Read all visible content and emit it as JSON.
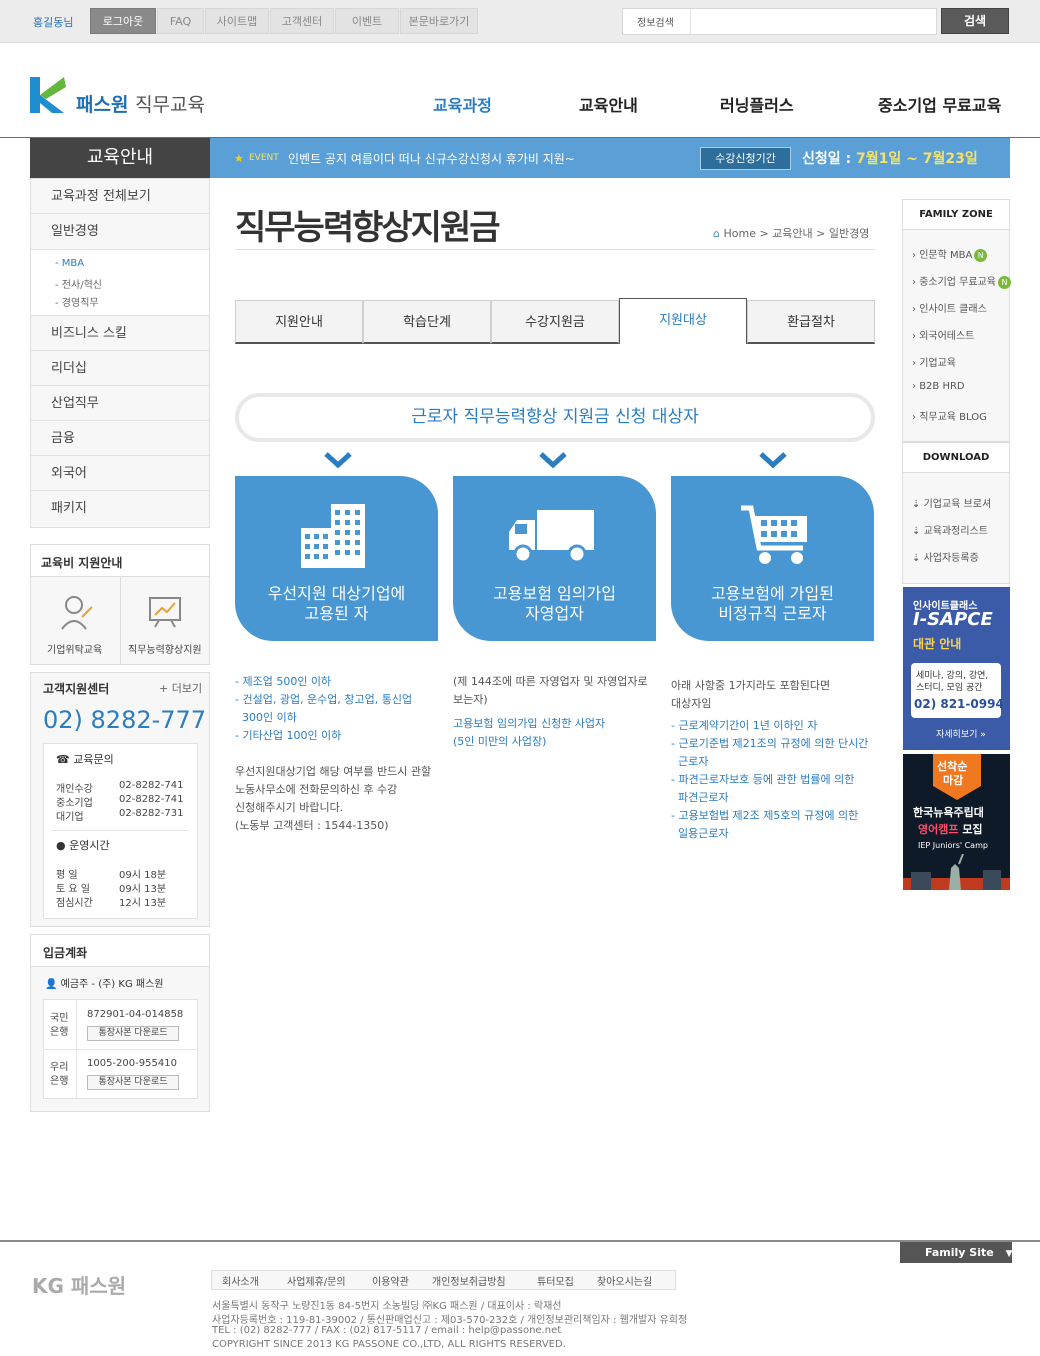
{
  "topbar": {
    "user": "홍길동님",
    "links": [
      "로그아웃",
      "FAQ",
      "사이트맵",
      "고객센터",
      "이벤트",
      "본문바로가기"
    ],
    "search_label": "정보검색",
    "search_placeholder": "",
    "search_button": "검색"
  },
  "logo": {
    "brand": "패스원",
    "sub": "직무교육"
  },
  "gnb": [
    "교육과정",
    "교육안내",
    "러닝플러스",
    "중소기업 무료교육"
  ],
  "lnb": {
    "title": "교육안내",
    "items": [
      "교육과정 전체보기",
      "일반경영",
      "비즈니스 스킬",
      "리더십",
      "산업직무",
      "금융",
      "외국어",
      "패키지"
    ],
    "subitems": [
      "MBA",
      "전사/혁신",
      "경영직무"
    ]
  },
  "event": {
    "label": "EVENT",
    "text": "인벤트 공지 여름이다 떠나 신규수강신청시 휴가비 지원~",
    "tag": "수강신청기간",
    "date_prefix": "신청일 :",
    "date_value": "7월1일 ~ 7월23일"
  },
  "support_panel": {
    "title": "교육비 지원안내",
    "items": [
      "기업위탁교육",
      "직무능력향상지원"
    ]
  },
  "cs_center": {
    "title": "고객지원센터",
    "more": "+ 더보기",
    "phone": "02) 8282-777",
    "inquiry_title": "교육문의",
    "inquiry": [
      {
        "label": "개인수강",
        "value": "02-8282-741"
      },
      {
        "label": "중소기업",
        "value": "02-8282-741"
      },
      {
        "label": "대기업",
        "value": "02-8282-731"
      }
    ],
    "hours_title": "운영시간",
    "hours": [
      {
        "label": "평 일",
        "value": "09시 18분"
      },
      {
        "label": "토 요 일",
        "value": "09시 13분"
      },
      {
        "label": "점심시간",
        "value": "12시 13분"
      }
    ]
  },
  "account": {
    "title": "입금계좌",
    "holder": "예금주 - (주) KG 패스원",
    "banks": [
      {
        "name": "국민\n은행",
        "number": "872901-04-014858",
        "button": "통장사본 다운로드"
      },
      {
        "name": "우리\n은행",
        "number": "1005-200-955410",
        "button": "통장사본 다운로드"
      }
    ]
  },
  "page": {
    "title": "직무능력향상지원금",
    "breadcrumb": "Home > 교육안내 > 일반경영"
  },
  "tabs": [
    "지원안내",
    "학습단계",
    "수강지원금",
    "지원대상",
    "환급절차"
  ],
  "active_tab": 3,
  "section_title": "근로자 직무능력향상 지원금 신청 대상자",
  "cards": [
    {
      "line1": "우선지원 대상기업에",
      "line2": "고용된 자"
    },
    {
      "line1": "고용보험 임의가입",
      "line2": "자영업자"
    },
    {
      "line1": "고용보험에 가입된",
      "line2": "비정규직 근로자"
    }
  ],
  "notes": {
    "col1_blue": [
      "- 제조업 500인 이하",
      "- 건설업, 광업, 운수업, 창고업, 통신업",
      "  300인 이하",
      "- 기타산업 100인 이하"
    ],
    "col1_gray": [
      "우선지원대상기업 해당 여부를 반드시 관할",
      "노동사무소에 전화문의하신 후 수강",
      "신청해주시기 바랍니다.",
      "(노동부 고객센터 : 1544-1350)"
    ],
    "col2_gray": [
      "(제 144조에 따른 자영업자 및 자영업자로",
      "보는자)"
    ],
    "col2_blue": [
      "고용보험 임의가입 신청한 사업자",
      "(5인 미만의 사업장)"
    ],
    "col3_gray": [
      "아래 사항중 1가지라도 포함된다면",
      "대상자임"
    ],
    "col3_blue": [
      "- 근로계약기간이 1년 이하인 자",
      "- 근로기준법 제21조의 규정에 의한 단시간",
      "  근로자",
      "- 파견근로자보호 등에 관한 법률에 의한",
      "  파견근로자",
      "- 고용보험법 제2조 제5호의 규정에 의한",
      "  일용근로자"
    ]
  },
  "family_zone": {
    "title": "FAMILY ZONE",
    "items": [
      "인문학 MBA",
      "중소기업 무료교육",
      "인사이트 클래스",
      "외국어테스트",
      "기업교육",
      "B2B HRD",
      "직무교육 BLOG"
    ],
    "new_badge": "N"
  },
  "download": {
    "title": "DOWNLOAD",
    "items": [
      "기업교육 브로셔",
      "교육과정리스트",
      "사업자등록증"
    ]
  },
  "banner1": {
    "line1": "인사이트클래스",
    "line2": "I-SAPCE",
    "line3": "대관 안내",
    "desc1": "세미나, 강의, 강연,",
    "desc2": "스터디, 모임 공간",
    "phone": "02) 821-0994",
    "more": "자세히보기 »"
  },
  "banner2": {
    "badge1": "선착순",
    "badge2": "마감",
    "line1": "한국뉴욕주립대",
    "line2": "영어캠프",
    "line2b": " 모집",
    "line3": "IEP Juniors' Camp"
  },
  "footer": {
    "family_site": "Family Site",
    "logo": "KG 패스원",
    "menu": [
      "회사소개",
      "사업제휴/문의",
      "이용약관",
      "개인정보취급방침",
      "튜터모집",
      "찾아오시는길"
    ],
    "address": [
      "서울특별시 동작구 노량진1동 84-5번지 소농빌딩 ㈜KG 패스원 / 대표이사 : 락재선",
      "사업자등록번호 : 119-81-39002 / 통신판매업신고 : 제03-570-232호 / 개인정보관리책임자 : 웹개발자 유희정",
      "TEL : (02) 8282-777 / FAX : (02) 817-5117 / email : help@passone.net",
      "COPYRIGHT SINCE 2013 KG PASSONE CO.,LTD, ALL RIGHTS RESERVED."
    ]
  },
  "colors": {
    "accent": "#2a7dc1",
    "card": "#4896d2",
    "dark": "#444444"
  }
}
